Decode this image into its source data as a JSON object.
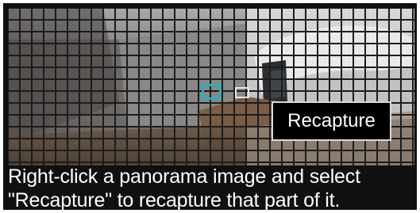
{
  "caption": {
    "line1": "Right-click a panorama image and select",
    "line2": "\"Recapture\" to recapture that part of it."
  },
  "tooltip": {
    "label": "Recapture"
  },
  "colors": {
    "selected_tile_outline": "#1fb3bd",
    "hover_tile_outline": "#e6e6e6",
    "grid_line": "#1c1c1c",
    "caption_text": "#ffffff",
    "tooltip_background": "#000000"
  }
}
